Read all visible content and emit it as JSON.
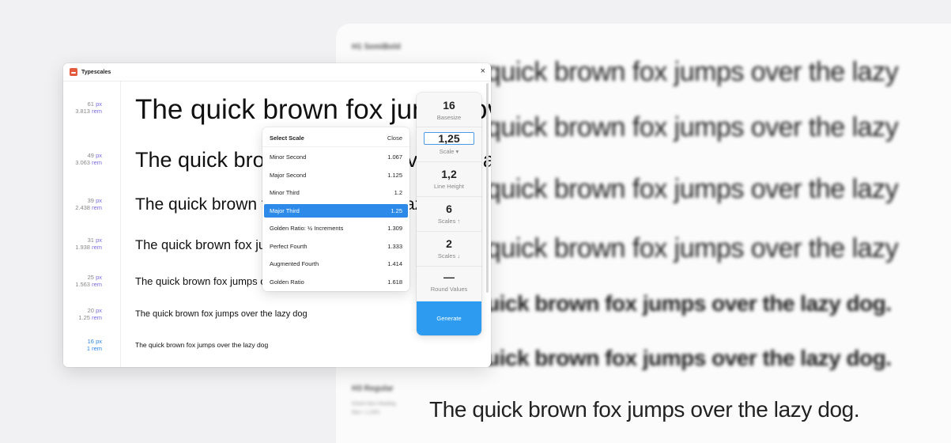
{
  "background": {
    "style_label_top": "H1 SemiBold",
    "style_label_bottom": "H3 Regular",
    "style_sub_1": "Inherit Hero Heading",
    "style_sub_2": "Max = 1.25%",
    "lines": [
      "quick brown fox jumps over the lazy",
      "quick brown fox jumps over the lazy",
      "quick brown fox jumps over the lazy",
      "quick brown fox jumps over the lazy",
      "uick brown fox jumps over the lazy dog.",
      "uick brown fox jumps over the lazy dog."
    ],
    "bottom_line": "The quick brown fox jumps over the lazy dog."
  },
  "window": {
    "title": "Typescales",
    "close": "×"
  },
  "scale_rows": [
    {
      "px_value": "61",
      "px_unit": "px",
      "rem_value": "3.813",
      "rem_unit": "rem",
      "text": "The quick brown fox jumps over the lazy dog"
    },
    {
      "px_value": "49",
      "px_unit": "px",
      "rem_value": "3.063",
      "rem_unit": "rem",
      "text": "The quick brown fox jumps over the lazy dog"
    },
    {
      "px_value": "39",
      "px_unit": "px",
      "rem_value": "2.438",
      "rem_unit": "rem",
      "text": "The quick brown fox jumps over the lazy dog"
    },
    {
      "px_value": "31",
      "px_unit": "px",
      "rem_value": "1.938",
      "rem_unit": "rem",
      "text": "The quick brown fox jumps over the lazy dog"
    },
    {
      "px_value": "25",
      "px_unit": "px",
      "rem_value": "1.563",
      "rem_unit": "rem",
      "text": "The quick brown fox jumps over the lazy dog"
    },
    {
      "px_value": "20",
      "px_unit": "px",
      "rem_value": "1.25",
      "rem_unit": "rem",
      "text": "The quick brown fox jumps over the lazy dog"
    },
    {
      "px_value": "16",
      "px_unit": "px",
      "rem_value": "1",
      "rem_unit": "rem",
      "text": "The quick brown fox jumps over the lazy dog"
    }
  ],
  "dropdown": {
    "title": "Select Scale",
    "close_label": "Close",
    "items": [
      {
        "name": "Minor Second",
        "value": "1.067"
      },
      {
        "name": "Major Second",
        "value": "1.125"
      },
      {
        "name": "Minor Third",
        "value": "1.2"
      },
      {
        "name": "Major Third",
        "value": "1.25",
        "selected": true
      },
      {
        "name": "Golden Ratio: ½ Increments",
        "value": "1.309"
      },
      {
        "name": "Perfect Fourth",
        "value": "1.333"
      },
      {
        "name": "Augmented Fourth",
        "value": "1.414"
      },
      {
        "name": "Golden Ratio",
        "value": "1.618"
      }
    ]
  },
  "panel": {
    "basesize_value": "16",
    "basesize_label": "Basesize",
    "scale_value": "1,25",
    "scale_label": "Scale ▾",
    "line_height_value": "1,2",
    "line_height_label": "Line Height",
    "scales_up_value": "6",
    "scales_up_label": "Scales ↑",
    "scales_down_value": "2",
    "scales_down_label": "Scales ↓",
    "round_values_value": "—",
    "round_values_label": "Round Values",
    "generate_label": "Generate"
  },
  "colors": {
    "accent": "#2d9cf0",
    "selected": "#2d8ae8",
    "rem_text": "#7a6de0"
  }
}
